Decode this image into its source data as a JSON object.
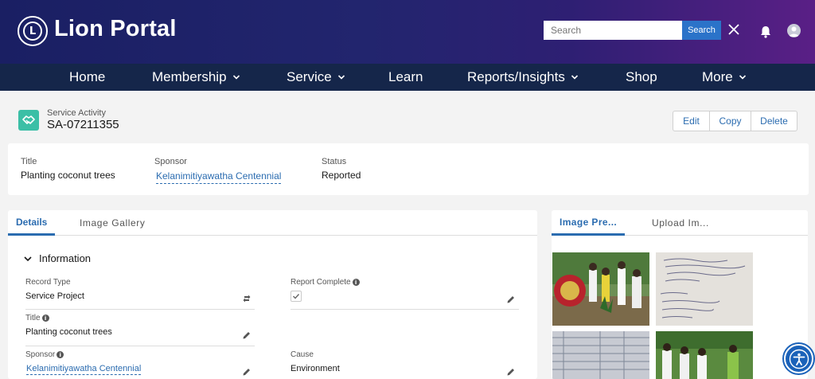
{
  "header": {
    "brand": "Lion Portal",
    "logo_text": "L",
    "search_placeholder": "Search",
    "search_button": "Search",
    "accent": "#2b73c9"
  },
  "nav": {
    "items": [
      {
        "label": "Home",
        "dropdown": false
      },
      {
        "label": "Membership",
        "dropdown": true
      },
      {
        "label": "Service",
        "dropdown": true
      },
      {
        "label": "Learn",
        "dropdown": false
      },
      {
        "label": "Reports/Insights",
        "dropdown": true
      },
      {
        "label": "Shop",
        "dropdown": false
      },
      {
        "label": "More",
        "dropdown": true
      }
    ]
  },
  "record": {
    "object_type": "Service Activity",
    "id": "SA-07211355",
    "icon": "handshake-icon",
    "actions": [
      "Edit",
      "Copy",
      "Delete"
    ]
  },
  "highlights": {
    "title_label": "Title",
    "title_value": "Planting coconut trees",
    "sponsor_label": "Sponsor",
    "sponsor_value": "Kelanimitiyawatha Centennial",
    "status_label": "Status",
    "status_value": "Reported"
  },
  "details": {
    "tabs": [
      "Details",
      "Image Gallery"
    ],
    "section_title": "Information",
    "fields": {
      "record_type_label": "Record Type",
      "record_type_value": "Service Project",
      "report_complete_label": "Report Complete",
      "report_complete_checked": true,
      "title_label": "Title",
      "title_value": "Planting coconut trees",
      "sponsor_label": "Sponsor",
      "sponsor_value": "Kelanimitiyawatha Centennial",
      "cause_label": "Cause",
      "cause_value": "Environment"
    }
  },
  "side": {
    "tabs": [
      "Image Pre...",
      "Upload Im..."
    ]
  }
}
